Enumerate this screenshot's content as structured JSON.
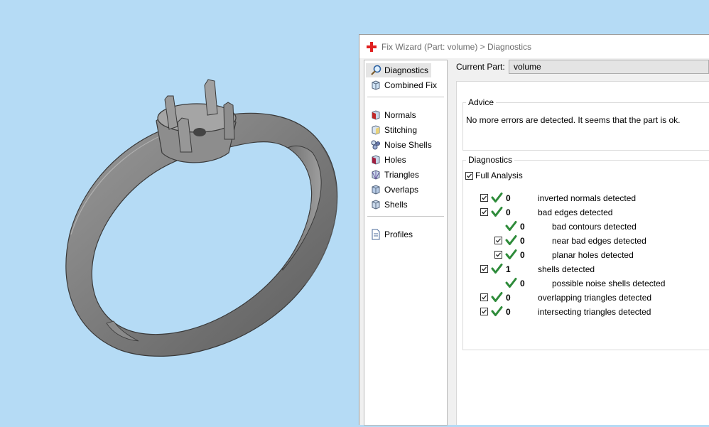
{
  "window": {
    "title": "Fix Wizard (Part: volume) > Diagnostics"
  },
  "nav": {
    "items": [
      {
        "label": "Diagnostics",
        "icon": "magnifier-icon",
        "selected": true
      },
      {
        "label": "Combined Fix",
        "icon": "combined-fix-icon"
      },
      {
        "label": "Normals",
        "icon": "normals-icon"
      },
      {
        "label": "Stitching",
        "icon": "stitching-icon"
      },
      {
        "label": "Noise Shells",
        "icon": "noise-shells-icon"
      },
      {
        "label": "Holes",
        "icon": "holes-icon"
      },
      {
        "label": "Triangles",
        "icon": "triangles-icon"
      },
      {
        "label": "Overlaps",
        "icon": "overlaps-icon"
      },
      {
        "label": "Shells",
        "icon": "shells-icon"
      },
      {
        "label": "Profiles",
        "icon": "profiles-icon"
      }
    ]
  },
  "current_part": {
    "label": "Current Part:",
    "value": "volume"
  },
  "advice": {
    "title": "Advice",
    "text": "No more errors are detected. It seems that the part is ok."
  },
  "diagnostics": {
    "title": "Diagnostics",
    "full_analysis_label": "Full Analysis",
    "full_analysis_checked": true,
    "rows": [
      {
        "checkbox": true,
        "count": "0",
        "text": "inverted normals detected",
        "indent": 0
      },
      {
        "checkbox": true,
        "count": "0",
        "text": "bad edges detected",
        "indent": 0
      },
      {
        "checkbox": false,
        "count": "0",
        "text": "bad contours detected",
        "indent": 1
      },
      {
        "checkbox": true,
        "count": "0",
        "text": "near bad edges detected",
        "indent": 1
      },
      {
        "checkbox": true,
        "count": "0",
        "text": "planar holes detected",
        "indent": 1
      },
      {
        "checkbox": true,
        "count": "1",
        "text": "shells detected",
        "indent": 0
      },
      {
        "checkbox": false,
        "count": "0",
        "text": "possible noise shells detected",
        "indent": 1
      },
      {
        "checkbox": true,
        "count": "0",
        "text": "overlapping triangles detected",
        "indent": 0
      },
      {
        "checkbox": true,
        "count": "0",
        "text": "intersecting triangles detected",
        "indent": 0
      }
    ]
  },
  "colors": {
    "viewport_bg": "#b5dbf5",
    "check_green": "#2e8b3a",
    "model_gray": "#7a7a7a"
  }
}
